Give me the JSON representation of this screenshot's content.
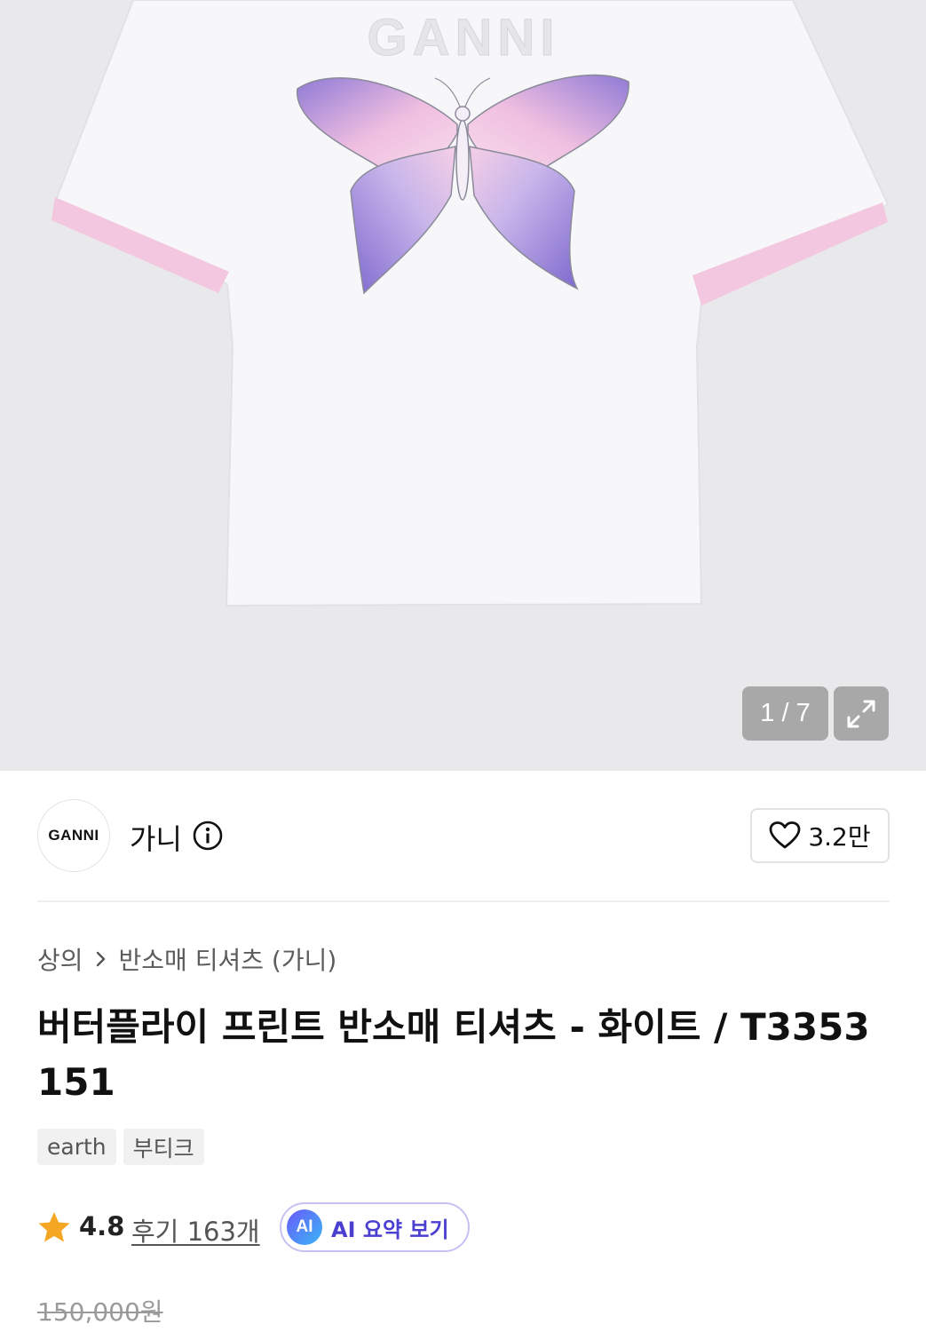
{
  "gallery": {
    "counter": "1 / 7",
    "print_text": "GANNI"
  },
  "brand": {
    "logo_text": "GANNI",
    "name": "가니",
    "likes": "3.2만"
  },
  "breadcrumb": {
    "category": "상의",
    "subcategory": "반소매 티셔츠 (가니)"
  },
  "product": {
    "title": "버터플라이 프린트 반소매 티셔츠 - 화이트 / T3353151",
    "tags": [
      "earth",
      "부티크"
    ],
    "rating": "4.8",
    "reviews": "후기 163개",
    "ai_badge": "AI",
    "ai_summary_label": "AI 요약 보기",
    "original_price": "150,000원"
  },
  "colors": {
    "star": "#f5a623",
    "ai_accent": "#4a3fcf",
    "sleeve_trim": "#f3c7df"
  },
  "icons": [
    "expand-icon",
    "info-icon",
    "heart-icon",
    "star-icon",
    "chevron-right-icon"
  ]
}
